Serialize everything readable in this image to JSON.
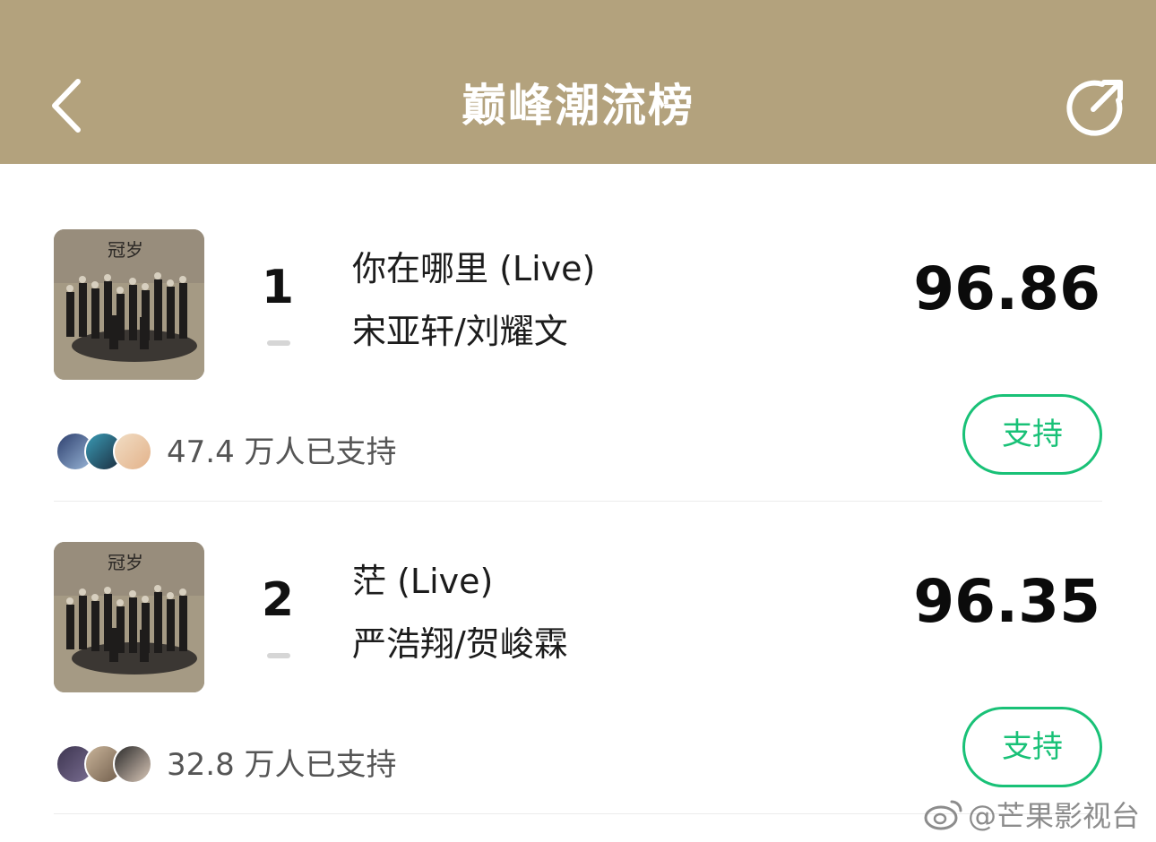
{
  "header": {
    "title": "巅峰潮流榜",
    "back_icon": "chevron-left-icon",
    "share_icon": "share-arrow-icon"
  },
  "items": [
    {
      "rank": "1",
      "title": "你在哪里 (Live)",
      "artist": "宋亚轩/刘耀文",
      "score": "96.86",
      "support_label": "支持",
      "support_count": "47.4 万人已支持",
      "cover_text": "冠岁"
    },
    {
      "rank": "2",
      "title": "茫 (Live)",
      "artist": "严浩翔/贺峻霖",
      "score": "96.35",
      "support_label": "支持",
      "support_count": "32.8 万人已支持",
      "cover_text": "冠岁"
    }
  ],
  "watermark": "@芒果影视台",
  "colors": {
    "header_bg": "#b3a27d",
    "accent_green": "#19c177"
  }
}
